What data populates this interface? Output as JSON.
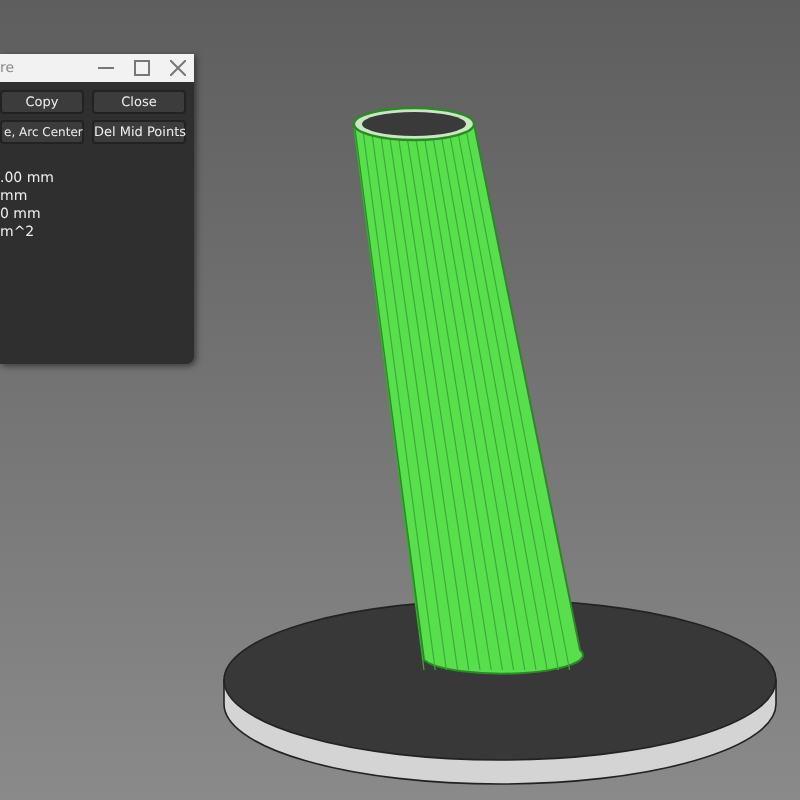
{
  "dialog": {
    "title": "re",
    "buttons": [
      {
        "label": "Copy"
      },
      {
        "label": "Close"
      },
      {
        "label": "e, Arc Center"
      },
      {
        "label": "Del Mid Points"
      }
    ],
    "lines": [
      ".00 mm",
      "mm",
      "0 mm",
      "m^2"
    ]
  }
}
